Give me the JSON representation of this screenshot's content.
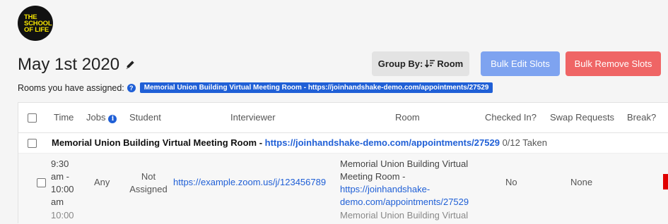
{
  "logo": {
    "lines": [
      "THE",
      "SCHOOL",
      "OF LIFE"
    ]
  },
  "page": {
    "title": "May 1st 2020"
  },
  "assigned": {
    "label": "Rooms you have assigned:",
    "badge": "Memorial Union Building Virtual Meeting Room - https://joinhandshake-demo.com/appointments/27529"
  },
  "toolbar": {
    "group_by_label": "Group By:",
    "group_by_value": "Room",
    "bulk_edit_label": "Bulk Edit Slots",
    "bulk_remove_label": "Bulk Remove Slots"
  },
  "table": {
    "headers": {
      "time": "Time",
      "jobs": "Jobs",
      "student": "Student",
      "interviewer": "Interviewer",
      "room": "Room",
      "checked_in": "Checked In?",
      "swap": "Swap Requests",
      "break": "Break?"
    },
    "group": {
      "name": "Memorial Union Building Virtual Meeting Room - ",
      "link": "https://joinhandshake-demo.com/appointments/27529",
      "taken": "0/12 Taken"
    },
    "slot": {
      "time_lines": [
        "9:30",
        "am -",
        "10:00",
        "am"
      ],
      "jobs": "Any",
      "student_lines": [
        "Not",
        "Assigned"
      ],
      "interviewer_link": "https://example.zoom.us/j/123456789",
      "room_lines": [
        "Memorial Union Building Virtual",
        "Meeting Room -"
      ],
      "room_link_lines": [
        "https://joinhandshake-",
        "demo.com/appointments/27529"
      ],
      "checked_in": "No",
      "swap": "None"
    },
    "next_slot_partial": {
      "time": "10:00",
      "room": "Memorial Union Building Virtual"
    }
  },
  "colors": {
    "primary": "#1f5fd6",
    "bulk_edit": "#7ea3f0",
    "bulk_remove": "#ef6565",
    "logo_text": "#f7e600"
  }
}
